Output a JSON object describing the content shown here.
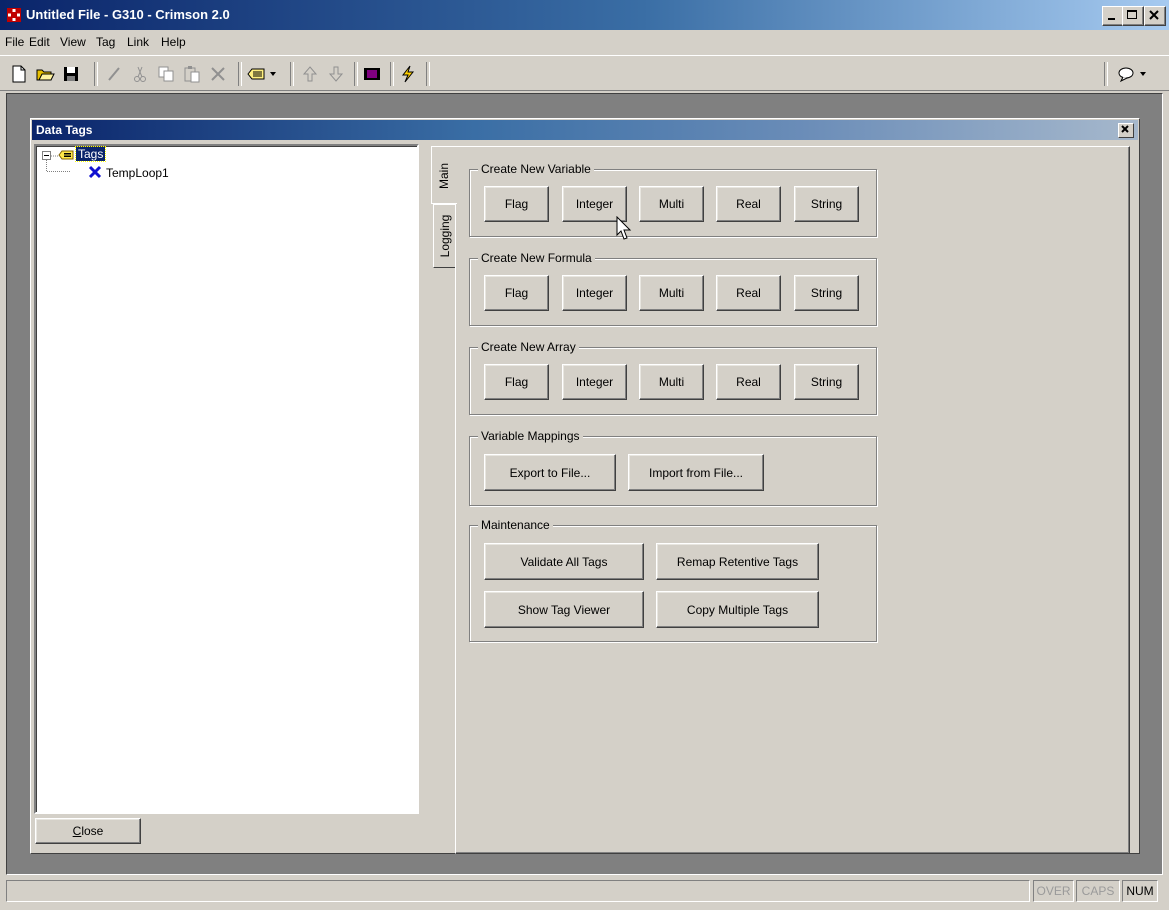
{
  "window": {
    "title": "Untitled File - G310 - Crimson 2.0"
  },
  "menu": [
    "File",
    "Edit",
    "View",
    "Tag",
    "Link",
    "Help"
  ],
  "toolbar": {
    "icons": [
      "new-file-icon",
      "open-folder-icon",
      "save-icon",
      "edit-pencil-icon",
      "cut-icon",
      "copy-icon",
      "paste-icon",
      "delete-icon",
      "tag-dropdown-icon",
      "move-up-icon",
      "move-down-icon",
      "display-icon",
      "lightning-icon",
      "help-balloon-icon"
    ]
  },
  "panel": {
    "title": "Data Tags",
    "close_label": "Close",
    "close_underline": "C"
  },
  "tree": {
    "root": "Tags",
    "children": [
      "TempLoop1"
    ]
  },
  "tabs": [
    "Main",
    "Logging"
  ],
  "groups": {
    "variable": {
      "label": "Create New Variable",
      "buttons": [
        "Flag",
        "Integer",
        "Multi",
        "Real",
        "String"
      ]
    },
    "formula": {
      "label": "Create New Formula",
      "buttons": [
        "Flag",
        "Integer",
        "Multi",
        "Real",
        "String"
      ]
    },
    "array": {
      "label": "Create New Array",
      "buttons": [
        "Flag",
        "Integer",
        "Multi",
        "Real",
        "String"
      ]
    },
    "mappings": {
      "label": "Variable Mappings",
      "buttons": [
        "Export to File...",
        "Import from File..."
      ]
    },
    "maintenance": {
      "label": "Maintenance",
      "buttons": [
        "Validate All Tags",
        "Remap Retentive Tags",
        "Show Tag Viewer",
        "Copy Multiple Tags"
      ]
    }
  },
  "status": {
    "over": "OVER",
    "caps": "CAPS",
    "num": "NUM"
  },
  "colors": {
    "title_start": "#0a246a",
    "title_end": "#a6caf0",
    "face": "#d4d0c8",
    "selection": "#0a246a"
  }
}
